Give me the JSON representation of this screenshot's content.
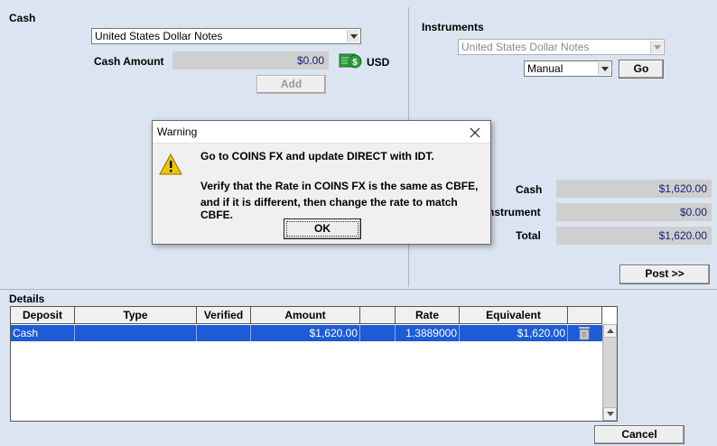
{
  "cash": {
    "section_label": "Cash",
    "currency_select": "United States Dollar Notes",
    "amount_label": "Cash Amount",
    "amount_value": "$0.00",
    "currency_code": "USD",
    "add_button": "Add"
  },
  "instruments": {
    "section_label": "Instruments",
    "instrument_select": "United States Dollar Notes",
    "mode_select": "Manual",
    "go_button": "Go"
  },
  "totals": {
    "cash_label": "Cash",
    "cash_value": "$1,620.00",
    "instrument_label": "nstrument",
    "instrument_value": "$0.00",
    "total_label": "Total",
    "total_value": "$1,620.00",
    "post_button": "Post >>"
  },
  "details": {
    "section_label": "Details",
    "columns": [
      "Deposit",
      "Type",
      "Verified",
      "Amount",
      "",
      "Rate",
      "Equivalent",
      ""
    ],
    "rows": [
      {
        "deposit": "Cash",
        "type": "",
        "verified": "",
        "amount": "$1,620.00",
        "blank": "",
        "rate": "1.3889000",
        "equivalent": "$1,620.00"
      }
    ]
  },
  "cancel_button": "Cancel",
  "dialog": {
    "title": "Warning",
    "line1": "Go to COINS FX and update DIRECT with IDT.",
    "line2": "Verify that the Rate in COINS FX is the same as CBFE,",
    "line3": "and if it is different, then change the rate to match CBFE.",
    "ok_button": "OK"
  },
  "colors": {
    "background": "#dbe5f1",
    "selected_row": "#1e5bd6",
    "value_text": "#1a1a7a",
    "money_icon": "#2e9a3a",
    "warning_icon": "#f2c400"
  }
}
